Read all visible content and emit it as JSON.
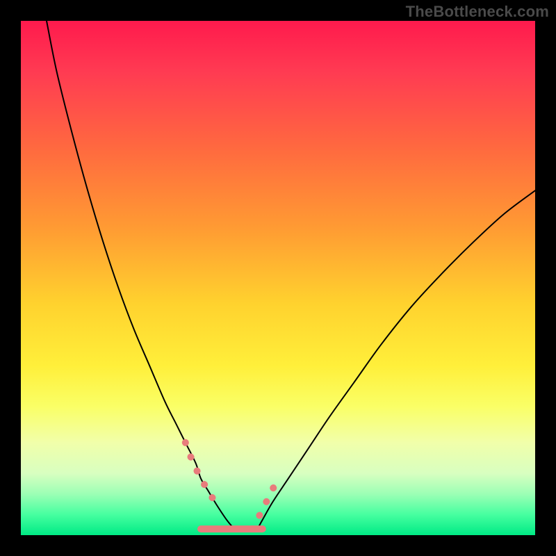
{
  "watermark": "TheBottleneck.com",
  "chart_data": {
    "type": "line",
    "title": "",
    "xlabel": "",
    "ylabel": "",
    "xlim": [
      0,
      100
    ],
    "ylim": [
      0,
      100
    ],
    "grid": false,
    "legend": false,
    "series": [
      {
        "name": "left-curve",
        "x": [
          5,
          7,
          10,
          13,
          16,
          19,
          22,
          25,
          28,
          30,
          32,
          34,
          35,
          36.5,
          38,
          40,
          41.5
        ],
        "y": [
          100,
          90,
          78,
          67,
          57,
          48,
          40,
          33,
          26,
          22,
          18,
          14,
          11,
          8.5,
          6,
          3,
          1.2
        ],
        "stroke": "#000000",
        "width": 2
      },
      {
        "name": "right-curve",
        "x": [
          46,
          47,
          49,
          52,
          56,
          60,
          65,
          70,
          76,
          82,
          88,
          94,
          100
        ],
        "y": [
          1.2,
          3,
          6.5,
          11,
          17,
          23,
          30,
          37,
          44.5,
          51,
          57,
          62.5,
          67
        ],
        "stroke": "#000000",
        "width": 2
      },
      {
        "name": "left-marker-dots",
        "x": [
          32,
          33.5,
          35,
          36.5,
          38
        ],
        "y": [
          18,
          14,
          11,
          8.5,
          6
        ],
        "stroke": "#e87c7c",
        "dash": true,
        "width": 10
      },
      {
        "name": "right-marker-dots",
        "x": [
          45,
          46.5,
          48,
          49.5
        ],
        "y": [
          1.2,
          4,
          7,
          10
        ],
        "stroke": "#e87c7c",
        "dash": true,
        "width": 10
      },
      {
        "name": "bottom-bar",
        "x": [
          35,
          47
        ],
        "y": [
          1.2,
          1.2
        ],
        "stroke": "#e87c7c",
        "width": 10
      }
    ]
  }
}
